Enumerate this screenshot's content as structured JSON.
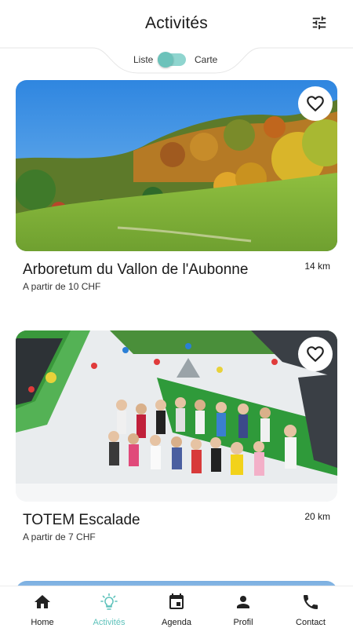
{
  "header": {
    "title": "Activités",
    "filter_icon": "tune-icon"
  },
  "view_toggle": {
    "left_label": "Liste",
    "right_label": "Carte",
    "selected": "Liste"
  },
  "activities": [
    {
      "name": "Arboretum du Vallon de l'Aubonne",
      "distance": "14 km",
      "price": "A partir de 10 CHF",
      "favorite": false,
      "image": "autumn-meadow-photo"
    },
    {
      "name": "TOTEM Escalade",
      "distance": "20 km",
      "price": "A partir de 7 CHF",
      "favorite": false,
      "image": "climbing-gym-group-photo"
    }
  ],
  "tabs": [
    {
      "label": "Home",
      "icon": "home-icon",
      "active": false
    },
    {
      "label": "Activités",
      "icon": "lightbulb-icon",
      "active": true
    },
    {
      "label": "Agenda",
      "icon": "calendar-icon",
      "active": false
    },
    {
      "label": "Profil",
      "icon": "person-icon",
      "active": false
    },
    {
      "label": "Contact",
      "icon": "phone-icon",
      "active": false
    }
  ],
  "colors": {
    "accent": "#5ec2bb",
    "toggle_track": "#8fd5cf",
    "text": "#1a1a1a"
  }
}
